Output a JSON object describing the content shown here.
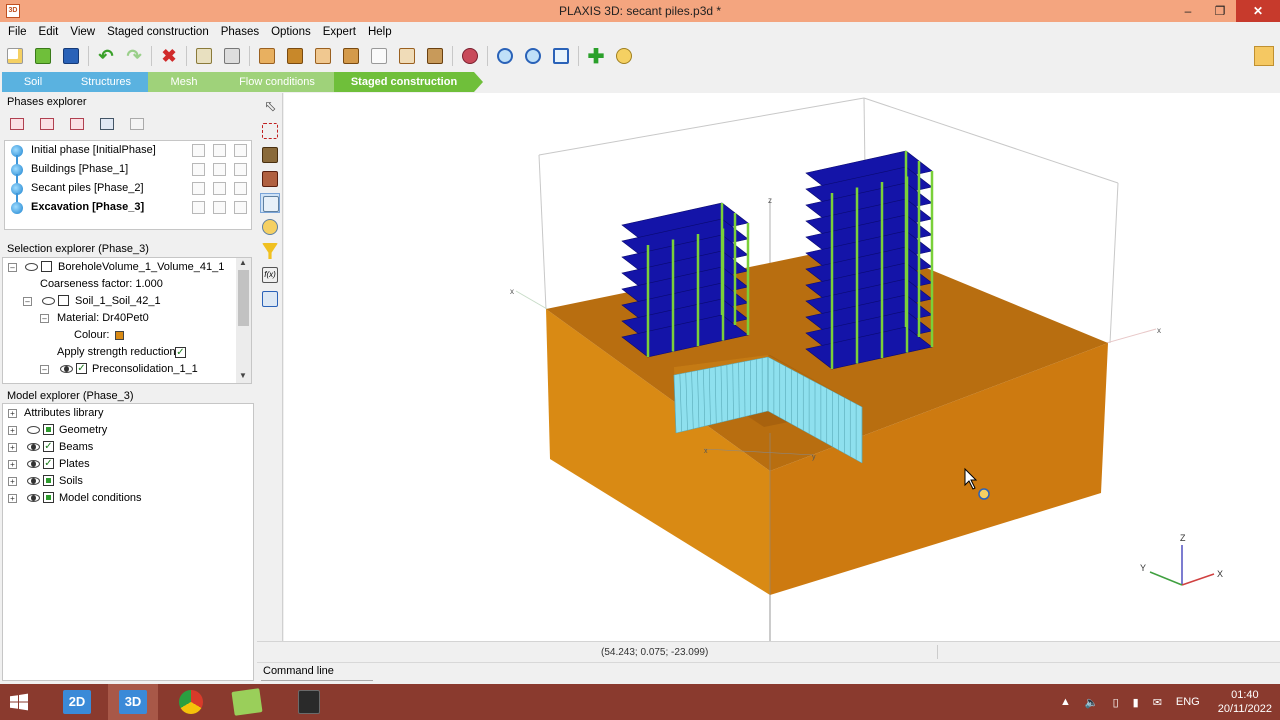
{
  "window": {
    "title": "PLAXIS 3D: secant piles.p3d *",
    "app_icon": "3D"
  },
  "menu": [
    "File",
    "Edit",
    "View",
    "Staged construction",
    "Phases",
    "Options",
    "Expert",
    "Help"
  ],
  "modes": {
    "soil": "Soil",
    "structures": "Structures",
    "mesh": "Mesh",
    "flow": "Flow conditions",
    "staged": "Staged construction"
  },
  "phases_explorer": {
    "title": "Phases explorer",
    "phases": [
      {
        "label": "Initial phase [InitialPhase]"
      },
      {
        "label": "Buildings [Phase_1]"
      },
      {
        "label": "Secant piles [Phase_2]"
      },
      {
        "label": "Excavation [Phase_3]"
      }
    ]
  },
  "selection_explorer": {
    "title": "Selection explorer (Phase_3)",
    "rows": [
      "BoreholeVolume_1_Volume_41_1",
      "Coarseness factor: 1.000",
      "Soil_1_Soil_42_1",
      "Material: Dr40Pet0",
      "Colour:",
      "Apply strength reduction:",
      "Preconsolidation_1_1"
    ]
  },
  "model_explorer": {
    "title": "Model explorer (Phase_3)",
    "rows": [
      "Attributes library",
      "Geometry",
      "Beams",
      "Plates",
      "Soils",
      "Model conditions"
    ]
  },
  "viewport": {
    "axis_labels": {
      "z": "z",
      "x": "x",
      "y": "y",
      "X": "X",
      "Y": "Y",
      "Z": "Z"
    },
    "colors": {
      "soil": "#d98a14",
      "soil_dark": "#c07410",
      "floor": "#1414a8",
      "column": "#7ad03a",
      "pile": "#8ee0ee"
    }
  },
  "status": {
    "coords": "(54.243; 0.075; -23.099)",
    "command_line": "Command line"
  },
  "taskbar": {
    "apps": [
      "2D",
      "3D",
      "chrome",
      "notes",
      "video"
    ],
    "lang": "ENG",
    "time": "01:40",
    "date": "20/11/2022"
  }
}
